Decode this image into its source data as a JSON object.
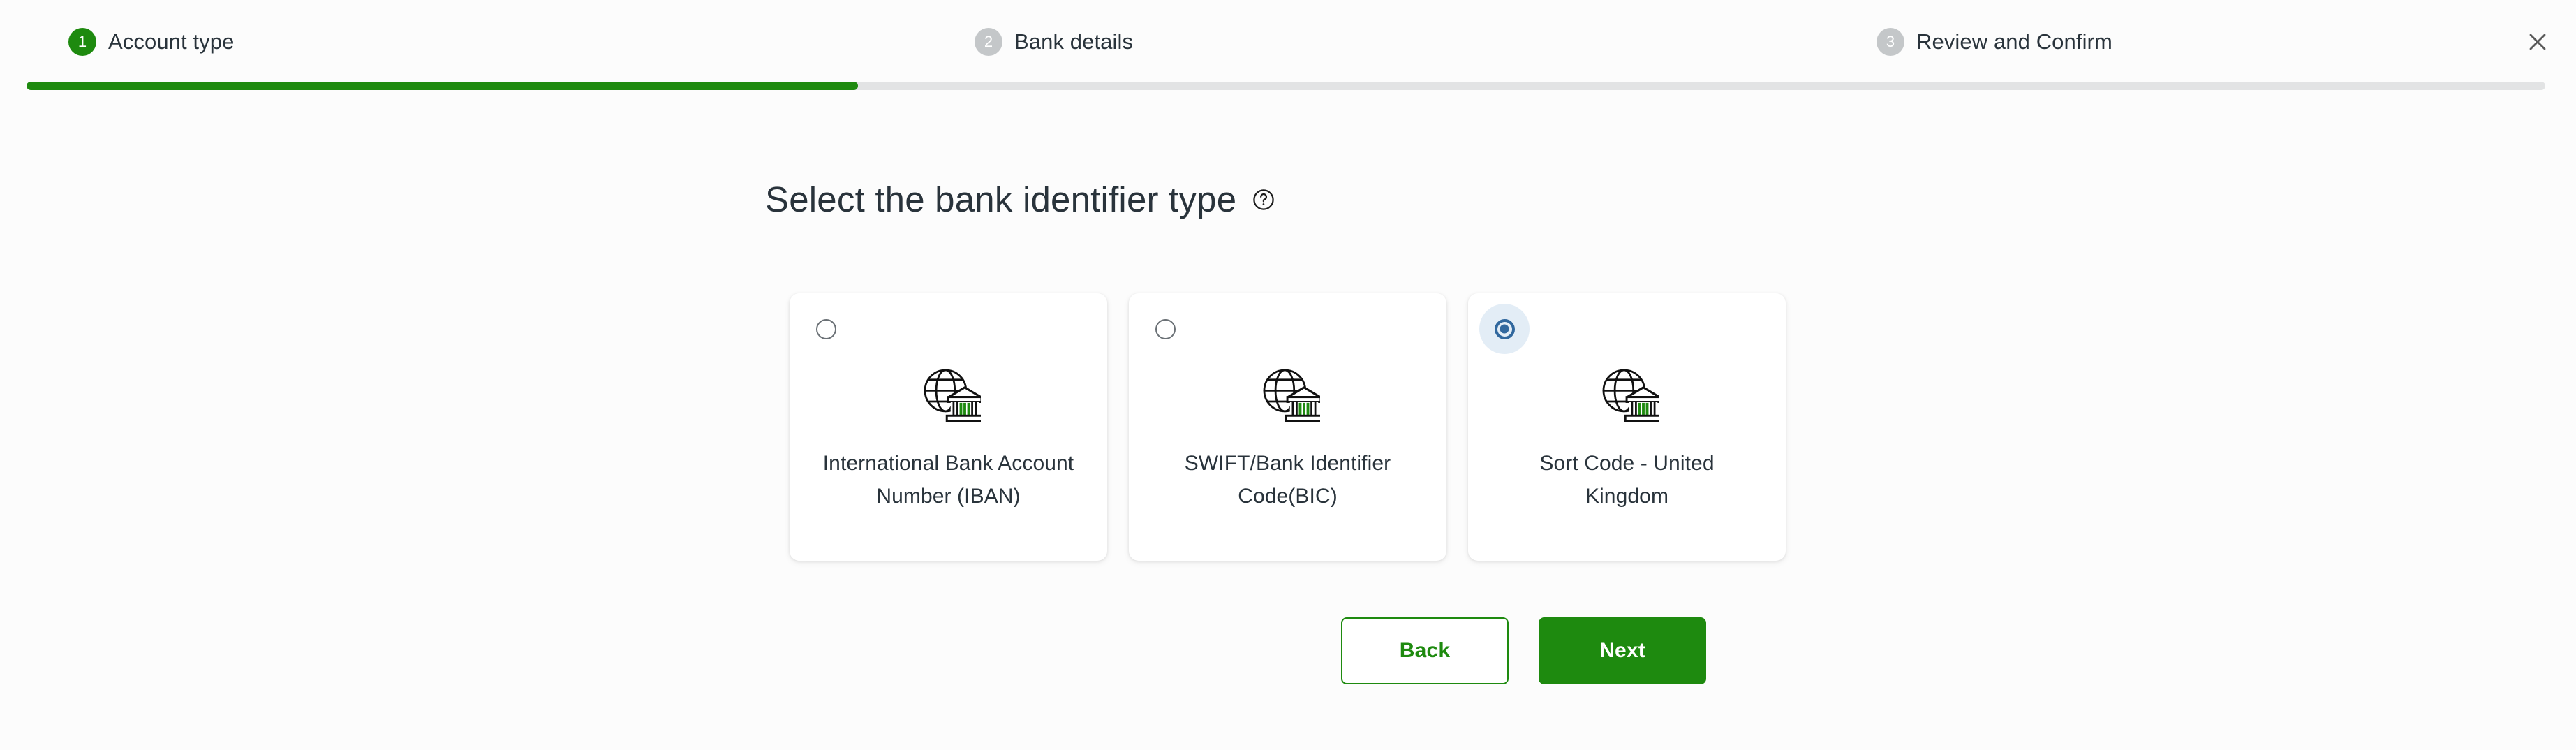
{
  "stepper": {
    "steps": [
      {
        "number": "1",
        "label": "Account type",
        "state": "active"
      },
      {
        "number": "2",
        "label": "Bank details",
        "state": "inactive"
      },
      {
        "number": "3",
        "label": "Review and Confirm",
        "state": "inactive"
      }
    ],
    "progress_percent": 33,
    "active_color": "#1e8a0f",
    "inactive_color": "#c4c7c9",
    "track_color": "#e2e3e4"
  },
  "close_button": {
    "icon": "close-icon"
  },
  "main": {
    "heading": "Select the bank identifier type",
    "help_icon": "help-circle-icon",
    "options": [
      {
        "label": "International Bank Account Number (IBAN)",
        "icon": "globe-bank-icon",
        "selected": false
      },
      {
        "label": "SWIFT/Bank Identifier Code(BIC)",
        "icon": "globe-bank-icon",
        "selected": false
      },
      {
        "label": "Sort Code - United Kingdom",
        "icon": "globe-bank-icon",
        "selected": true
      }
    ],
    "selected_option_index": 2,
    "selected_radio_color": "#31689e",
    "selected_radio_halo_color": "#e3edf6"
  },
  "actions": {
    "back_label": "Back",
    "next_label": "Next",
    "primary_color": "#1e8a0f"
  }
}
